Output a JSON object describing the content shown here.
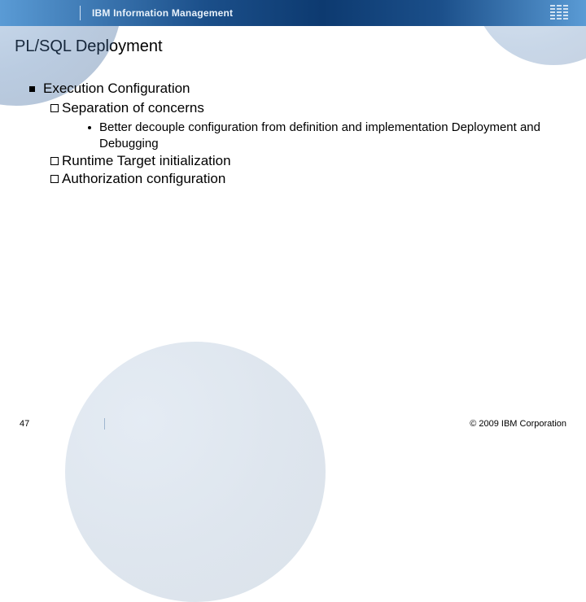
{
  "header": {
    "brand": "IBM Information Management",
    "logo_alt": "IBM"
  },
  "slide": {
    "title": "PL/SQL Deployment"
  },
  "bullets": {
    "l1": "Execution Configuration",
    "l2a": "Separation of concerns",
    "l3a": "Better decouple configuration from definition and implementation Deployment and Debugging",
    "l2b": "Runtime Target initialization",
    "l2c": "Authorization configuration"
  },
  "footer": {
    "page": "47",
    "copyright": "© 2009 IBM Corporation"
  }
}
